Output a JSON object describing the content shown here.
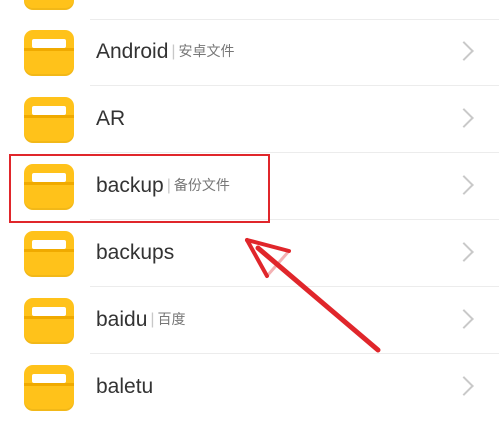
{
  "folders": [
    {
      "name": "",
      "desc": ""
    },
    {
      "name": "Android",
      "desc": "安卓文件"
    },
    {
      "name": "AR",
      "desc": ""
    },
    {
      "name": "backup",
      "desc": "备份文件"
    },
    {
      "name": "backups",
      "desc": ""
    },
    {
      "name": "baidu",
      "desc": "百度"
    },
    {
      "name": "baletu",
      "desc": ""
    }
  ],
  "separator": "|",
  "icons": {
    "folder": "folder-icon",
    "chevron": "chevron-right-icon"
  },
  "colors": {
    "folder": "#ffc21a",
    "highlight": "#e0262b",
    "arrow": "#e0262b",
    "divider": "#ececec"
  }
}
